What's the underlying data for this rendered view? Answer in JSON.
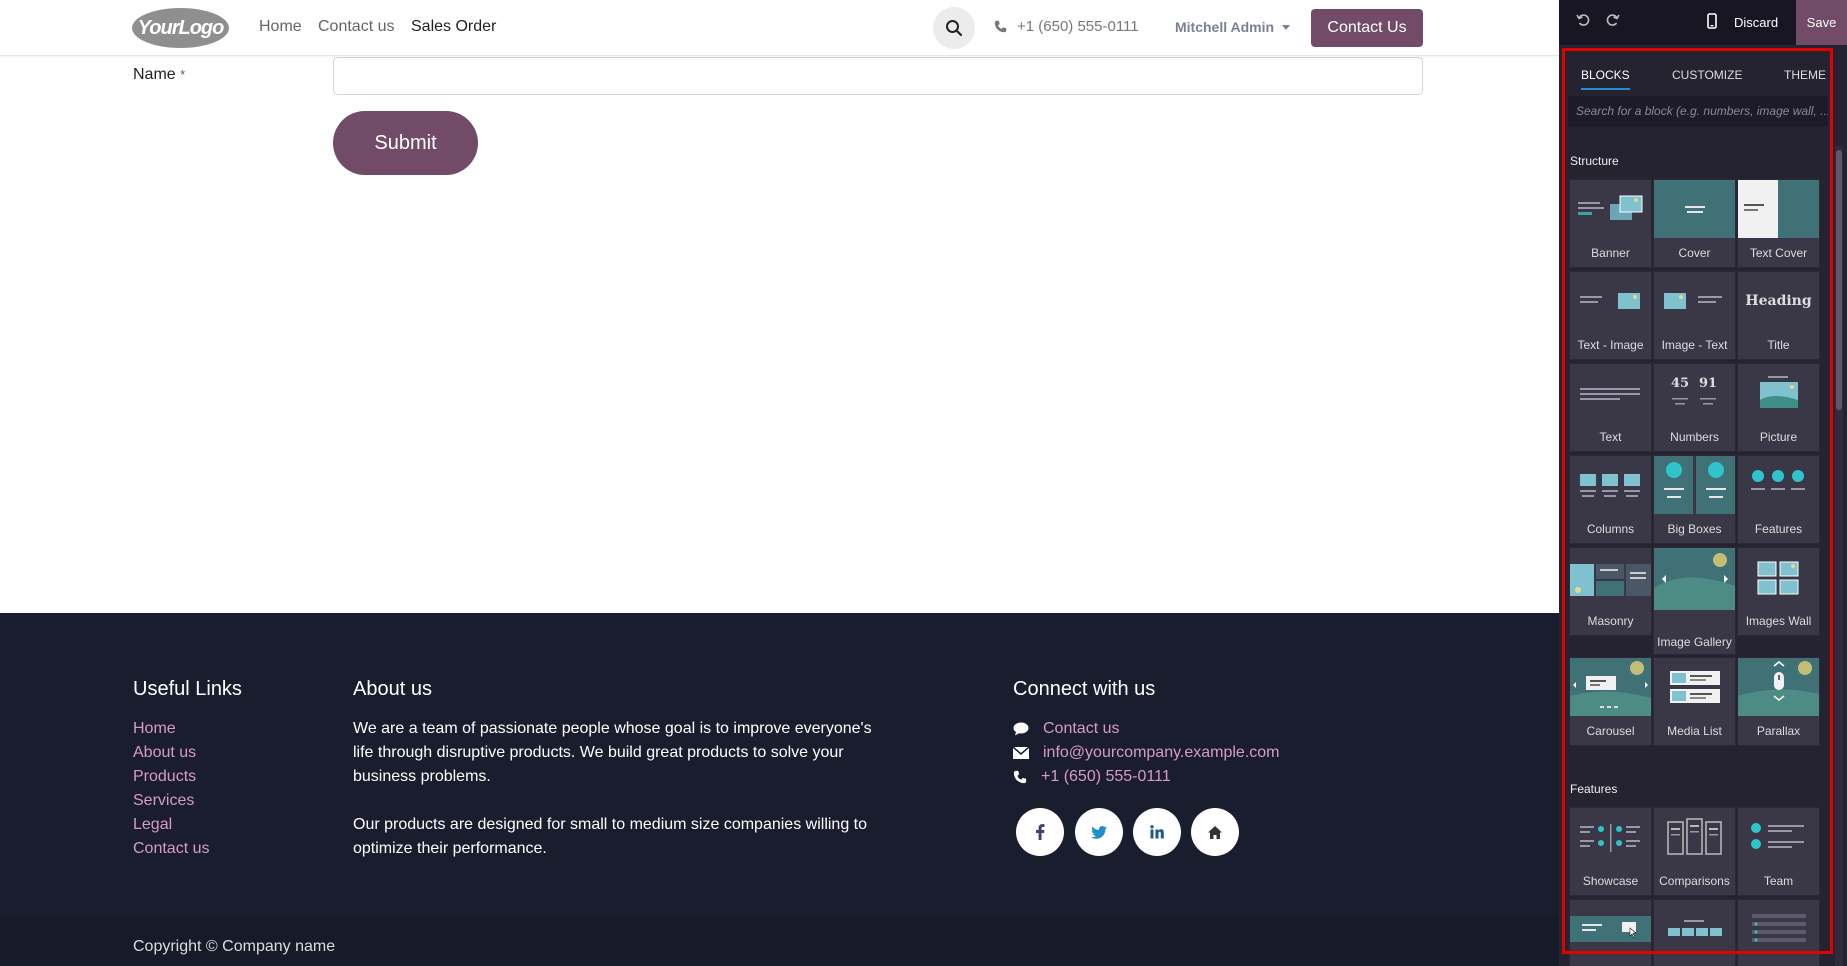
{
  "header": {
    "logo": "YourLogo",
    "nav": [
      "Home",
      "Contact us",
      "Sales Order"
    ],
    "phone": "+1 (650) 555-0111",
    "user": "Mitchell Admin",
    "contact_button": "Contact Us"
  },
  "form": {
    "name_label": "Name",
    "required_mark": "*",
    "submit_label": "Submit"
  },
  "footer": {
    "useful_links_title": "Useful Links",
    "links": [
      "Home",
      "About us",
      "Products",
      "Services",
      "Legal",
      "Contact us"
    ],
    "about_title": "About us",
    "about_p1": "We are a team of passionate people whose goal is to improve everyone's life through disruptive products. We build great products to solve your business problems.",
    "about_p2": "Our products are designed for small to medium size companies willing to optimize their performance.",
    "connect_title": "Connect with us",
    "contact_link": "Contact us",
    "email": "info@yourcompany.example.com",
    "phone": "+1 (650) 555-0111",
    "copyright": "Copyright © Company name"
  },
  "editor": {
    "discard": "Discard",
    "save": "Save",
    "tabs": [
      "BLOCKS",
      "CUSTOMIZE",
      "THEME"
    ],
    "search_placeholder": "Search for a block (e.g. numbers, image wall, ...)",
    "structure_label": "Structure",
    "features_label": "Features",
    "structure_blocks": [
      "Banner",
      "Cover",
      "Text Cover",
      "Text - Image",
      "Image - Text",
      "Title",
      "Text",
      "Numbers",
      "Picture",
      "Columns",
      "Big Boxes",
      "Features",
      "Masonry",
      "Image Gallery",
      "Images Wall",
      "Carousel",
      "Media List",
      "Parallax"
    ],
    "feature_blocks": [
      "Showcase",
      "Comparisons",
      "Team"
    ],
    "title_thumb_text": "Heading",
    "numbers_thumb": [
      "45",
      "91"
    ]
  },
  "colors": {
    "brand": "#714b67",
    "footer_bg": "#1a1d2e",
    "panel_bg": "#262331",
    "accent_teal": "#3aa4a8",
    "highlight": "#e30000"
  }
}
